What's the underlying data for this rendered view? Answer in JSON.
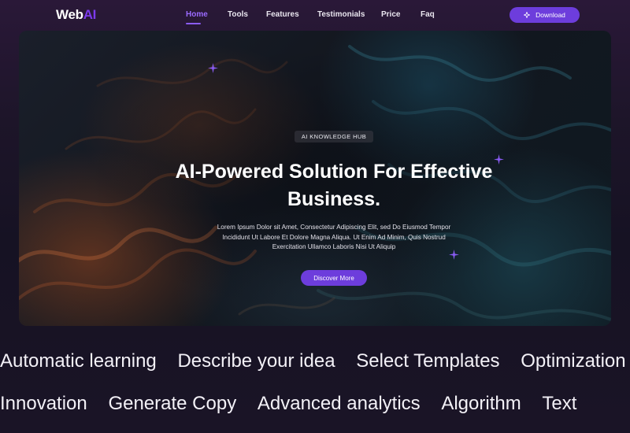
{
  "logo": {
    "text": "Web",
    "accent": "AI"
  },
  "nav": {
    "items": [
      {
        "label": "Home",
        "active": true
      },
      {
        "label": "Tools"
      },
      {
        "label": "Features"
      },
      {
        "label": "Testimonials"
      },
      {
        "label": "Price"
      },
      {
        "label": "Faq"
      }
    ],
    "download_label": "Download"
  },
  "hero": {
    "badge": "AI KNOWLEDGE HUB",
    "title_line1": "AI-Powered Solution For Effective",
    "title_line2": "Business.",
    "desc_line1": "Lorem Ipsum Dolor sit Amet, Consectetur Adipiscing Elit, sed Do Eiusmod Tempor",
    "desc_line2": "Incididunt Ut Labore Et Dolore Magna Aliqua. Ut Enim Ad Minim, Quis Nostrud",
    "desc_line3": "Exercitation Ullamco Laboris Nisi Ut Aliquip",
    "cta_label": "Discover More"
  },
  "marquee": {
    "row1": [
      "Automatic learning",
      "Describe your idea",
      "Select Templates",
      "Optimization"
    ],
    "row2": [
      "Innovation",
      "Generate Copy",
      "Advanced analytics",
      "Algorithm",
      "Text"
    ]
  },
  "colors": {
    "accent": "#6d3ddc",
    "active_nav": "#9b6bff",
    "background": "#1a1426"
  },
  "icons": {
    "download": "diamond-sparkle-icon",
    "sparkle": "star-sparkle-icon"
  }
}
